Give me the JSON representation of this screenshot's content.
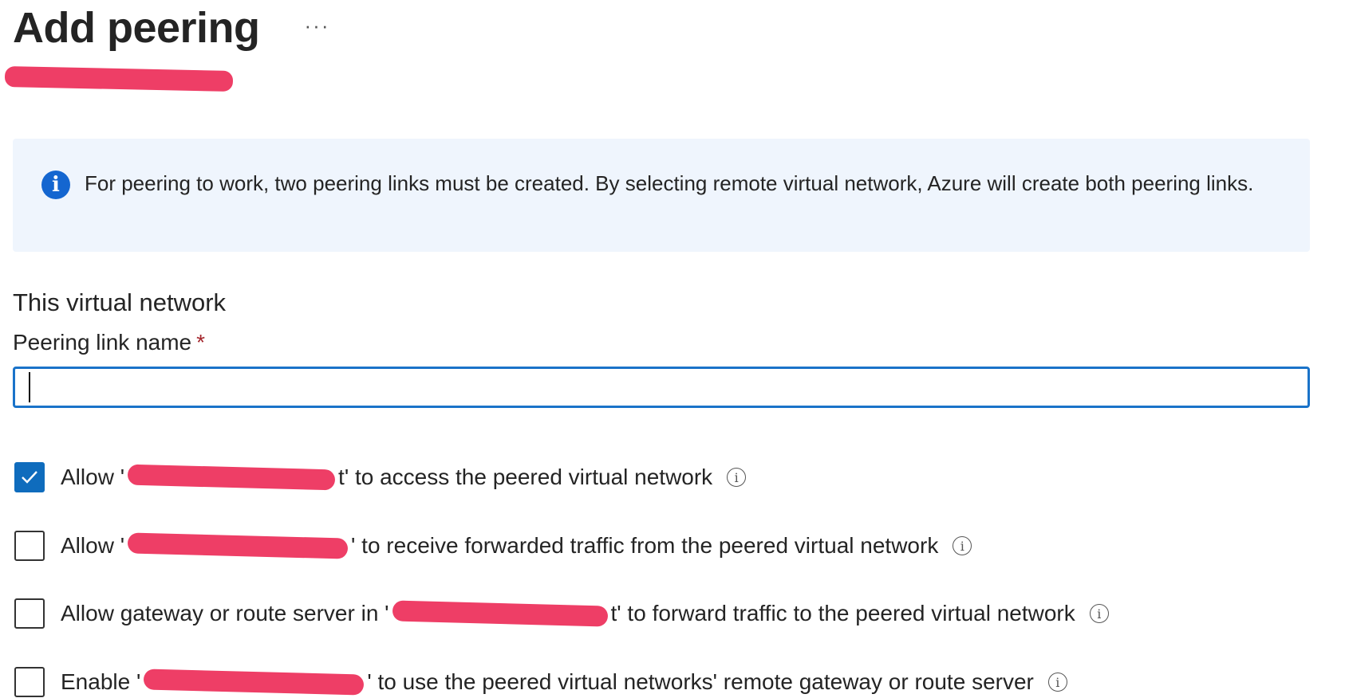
{
  "header": {
    "title": "Add peering",
    "more_label": "···"
  },
  "info": {
    "text": "For peering to work, two peering links must be created. By selecting remote virtual network, Azure will create both peering links."
  },
  "section": {
    "title": "This virtual network"
  },
  "field": {
    "label": "Peering link name",
    "required_mark": "*",
    "value": "",
    "placeholder": ""
  },
  "options": [
    {
      "prefix": "Allow '",
      "suffix": "t' to access the peered virtual network",
      "checked": true
    },
    {
      "prefix": "Allow '",
      "suffix": "' to receive forwarded traffic from the peered virtual network",
      "checked": false
    },
    {
      "prefix": "Allow gateway or route server in '",
      "suffix": "t' to forward traffic to the peered virtual network",
      "checked": false
    },
    {
      "prefix": "Enable '",
      "suffix": "' to use the peered virtual networks' remote gateway or route server",
      "checked": false
    }
  ],
  "colors": {
    "accent": "#0f6cbd",
    "info_bg": "#eff5fd",
    "info_icon": "#1466d0",
    "required": "#a4262c",
    "redaction": "#ee3e66"
  },
  "icons": {
    "info": "info-icon",
    "tooltip": "info-circle-icon",
    "checkmark": "checkmark-icon",
    "more": "ellipsis-icon"
  }
}
